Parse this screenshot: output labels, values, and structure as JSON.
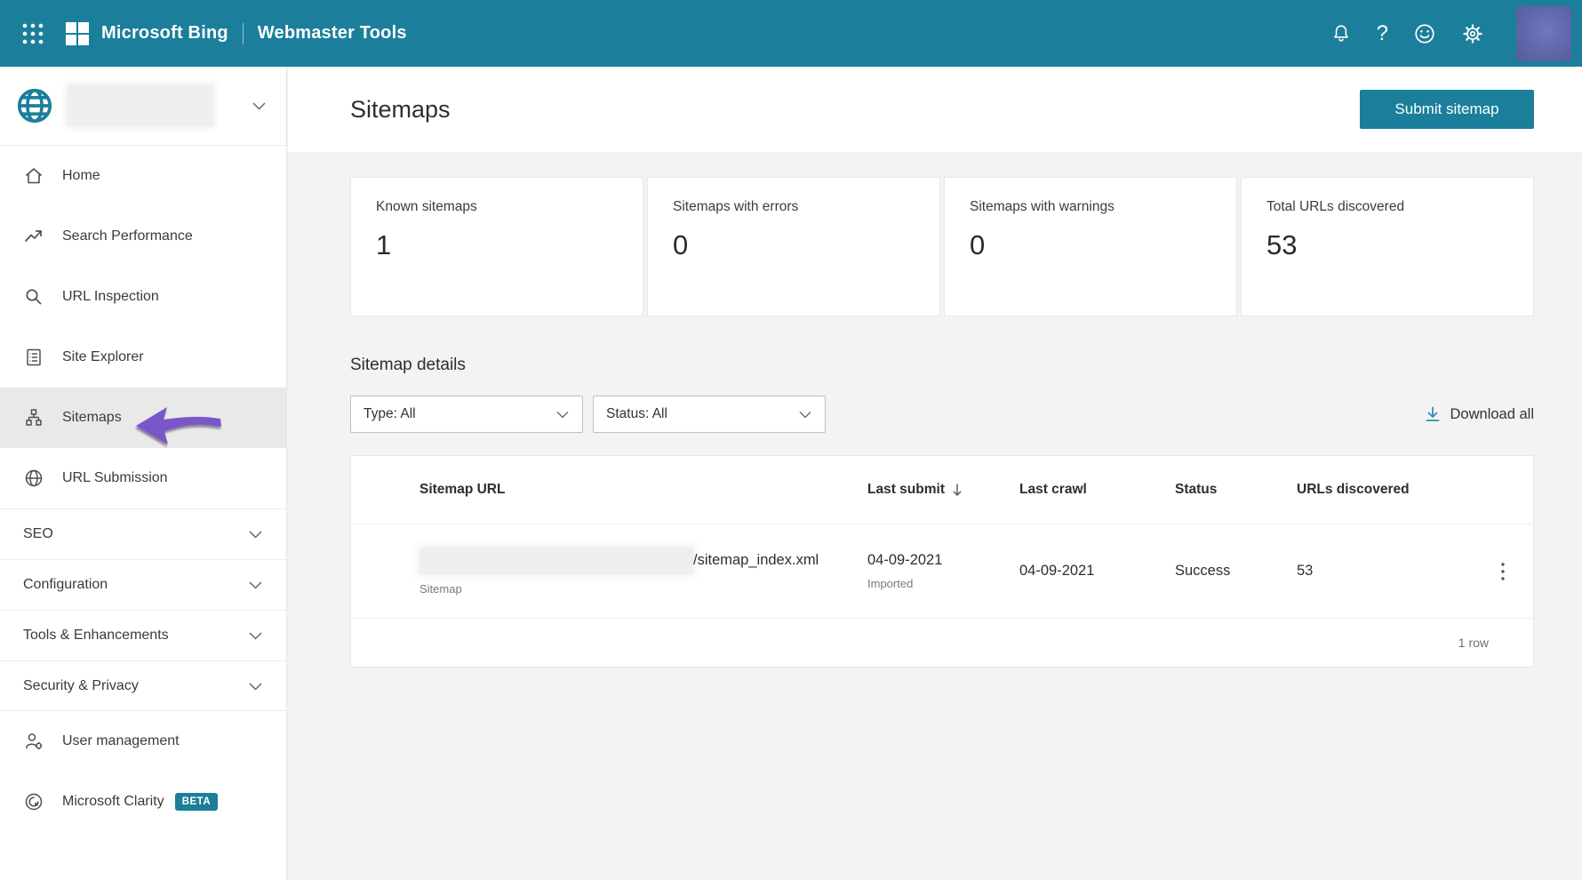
{
  "header": {
    "brand": "Microsoft Bing",
    "product": "Webmaster Tools",
    "icons": {
      "apps_launcher": "grid-dots",
      "notifications": "bell",
      "help_glyph": "?",
      "feedback": "smiley",
      "settings": "gear",
      "avatar": "user-avatar-blurred"
    }
  },
  "sidebar": {
    "site_selector": {
      "icon": "globe",
      "site_name_state": "blurred"
    },
    "items": [
      {
        "label": "Home",
        "icon": "home"
      },
      {
        "label": "Search Performance",
        "icon": "trend-up"
      },
      {
        "label": "URL Inspection",
        "icon": "magnifier"
      },
      {
        "label": "Site Explorer",
        "icon": "document-list"
      },
      {
        "label": "Sitemaps",
        "icon": "hierarchy",
        "active": true
      },
      {
        "label": "URL Submission",
        "icon": "globe"
      },
      {
        "label": "SEO",
        "expandable": true
      },
      {
        "label": "Configuration",
        "expandable": true
      },
      {
        "label": "Tools & Enhancements",
        "expandable": true
      },
      {
        "label": "Security & Privacy",
        "expandable": true
      },
      {
        "label": "User management",
        "icon": "person-gear"
      },
      {
        "label": "Microsoft Clarity",
        "icon": "clarity",
        "badge": "BETA"
      }
    ]
  },
  "page": {
    "title": "Sitemaps",
    "submit_button": "Submit sitemap"
  },
  "stats_cards": [
    {
      "label": "Known sitemaps",
      "value": "1"
    },
    {
      "label": "Sitemaps with errors",
      "value": "0"
    },
    {
      "label": "Sitemaps with warnings",
      "value": "0"
    },
    {
      "label": "Total URLs discovered",
      "value": "53"
    }
  ],
  "details": {
    "heading": "Sitemap details",
    "type_filter": "Type: All",
    "status_filter": "Status: All",
    "download_all": "Download all"
  },
  "table": {
    "columns": [
      "Sitemap URL",
      "Last submit",
      "Last crawl",
      "Status",
      "URLs discovered"
    ],
    "sorted_by": "Last submit",
    "rows": [
      {
        "url_state": "blurred",
        "url_path": "/sitemap_index.xml",
        "url_kind": "Sitemap",
        "last_submit": "04-09-2021",
        "last_submit_note": "Imported",
        "last_crawl": "04-09-2021",
        "status": "Success",
        "urls_discovered": "53"
      }
    ],
    "footer": "1 row"
  },
  "annotation": {
    "type": "arrow",
    "points_to": "sitemaps-nav-item",
    "color": "#7a57c8"
  },
  "colors": {
    "header_bg": "#1b7f9b",
    "accent": "#1b7f9b",
    "beta_badge": "#1b7f9b",
    "download_icon": "#2e8fb8",
    "active_nav_bg": "#e9e9e9",
    "main_bg": "#f3f3f3"
  }
}
